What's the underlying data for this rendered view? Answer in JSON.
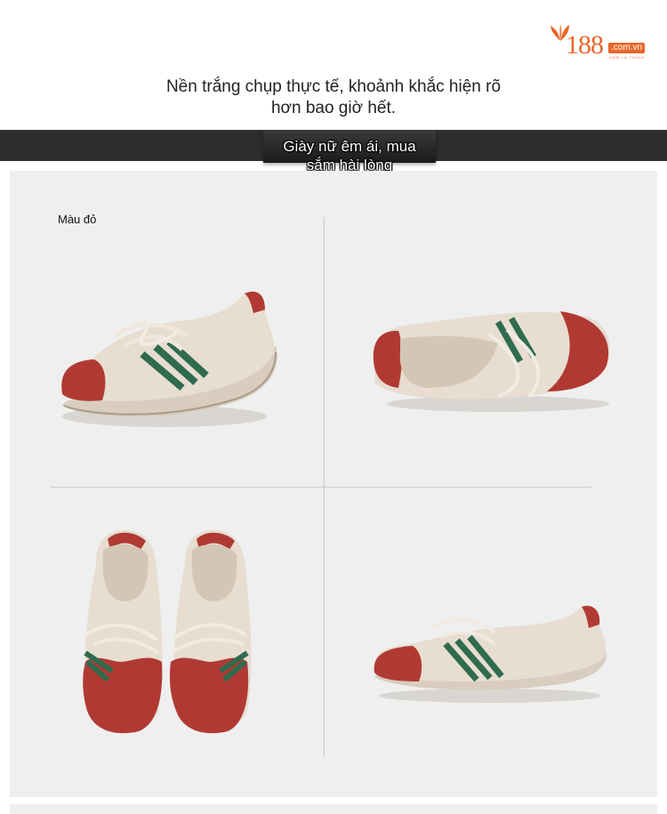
{
  "logo": {
    "number": "188",
    "domain": ".com.vn",
    "tagline": "XEM LÀ THÍCH",
    "color": "#e8672a"
  },
  "intro": {
    "line1": "Nền trắng chụp thực tế, khoảnh khắc hiện rõ",
    "line2": "hơn bao giờ hết."
  },
  "banner": {
    "line1": "Giày nữ êm ái, mua",
    "line2": "sắm hài lòng"
  },
  "gallery": {
    "color_label": "Màu đỏ",
    "photos": [
      "shoe-side-view",
      "shoe-top-angle-view",
      "shoe-pair-front-view",
      "shoe-side-view-right"
    ]
  },
  "colors": {
    "shoe_red": "#b03a33",
    "shoe_cream": "#e7ddd0",
    "shoe_green": "#2f6b4e",
    "sole": "#d8cdbe"
  }
}
